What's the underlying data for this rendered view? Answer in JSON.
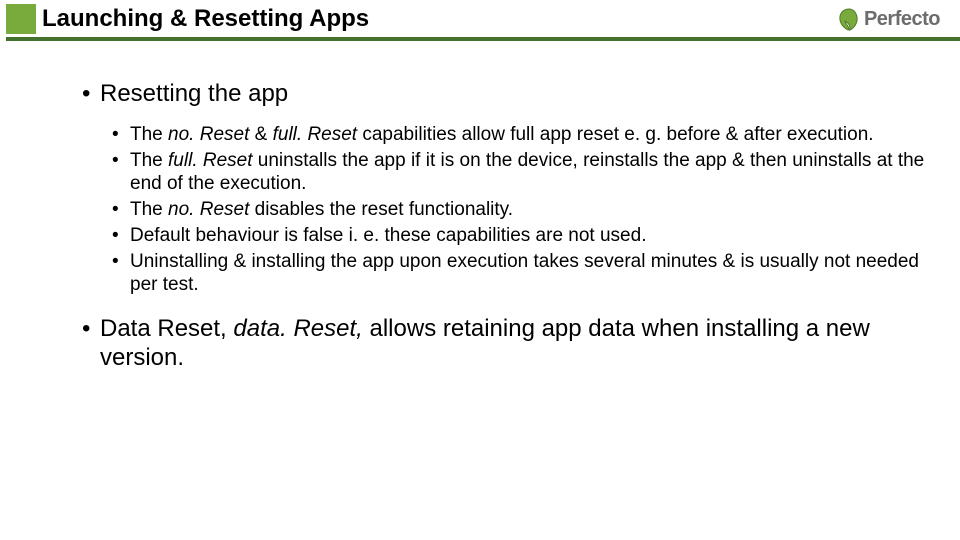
{
  "brand": {
    "name": "Perfecto"
  },
  "title": "Launching & Resetting Apps",
  "section1": {
    "heading": "Resetting the app",
    "items": {
      "b1_a": "The ",
      "b1_i1": "no. Reset",
      "b1_b": " & ",
      "b1_i2": "full. Reset",
      "b1_c": " capabilities allow full app reset e. g. before & after execution.",
      "b2_a": "The ",
      "b2_i1": "full. Reset",
      "b2_b": " uninstalls the app if it is on the device, reinstalls the app & then uninstalls at the end of the execution.",
      "b3_a": "The ",
      "b3_i1": "no. Reset",
      "b3_b": " disables the reset functionality.",
      "b4": "Default behaviour is false i. e. these capabilities are not used.",
      "b5": "Uninstalling & installing the app upon execution takes several minutes & is usually not needed per test."
    }
  },
  "section2": {
    "p_a": "Data Reset, ",
    "p_i": "data. Reset,",
    "p_b": " allows retaining app data when installing a new version."
  }
}
